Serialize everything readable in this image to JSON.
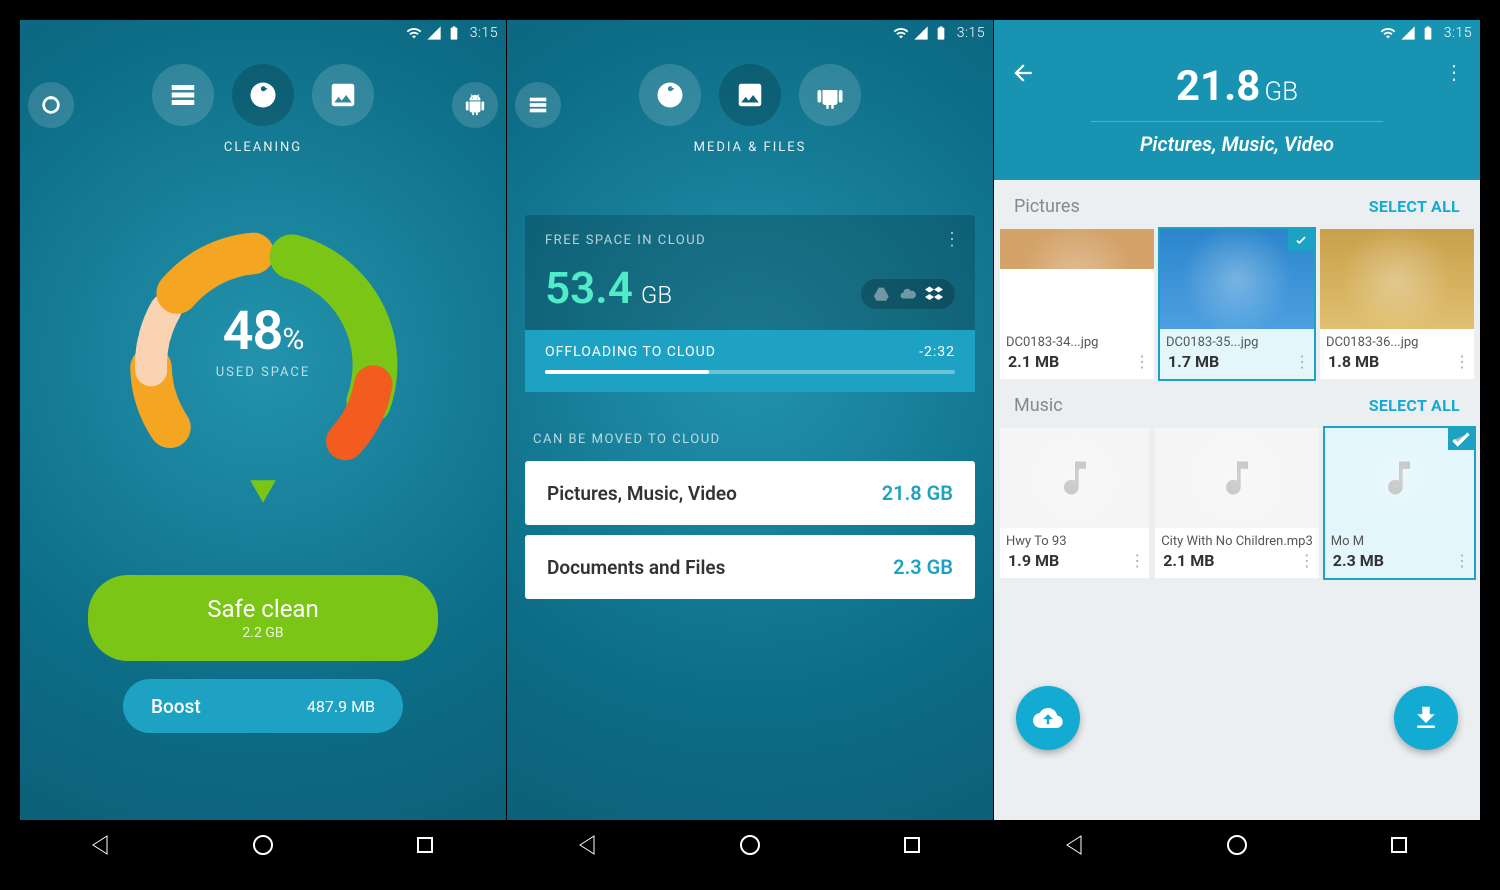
{
  "status": {
    "time": "3:15"
  },
  "screen1": {
    "circles_label": "CLEANING",
    "used_pct_number": "48",
    "used_pct_symbol": "%",
    "used_label": "USED SPACE",
    "safe_clean_label": "Safe clean",
    "safe_clean_amount": "2.2 GB",
    "boost_label": "Boost",
    "boost_amount": "487.9 MB"
  },
  "screen2": {
    "circles_label": "MEDIA & FILES",
    "cloud_title": "FREE SPACE IN CLOUD",
    "cloud_value": "53.4",
    "cloud_unit": "GB",
    "offload_label": "OFFLOADING TO CLOUD",
    "offload_time": "-2:32",
    "movable_label": "CAN BE MOVED TO CLOUD",
    "cards": [
      {
        "label": "Pictures, Music, Video",
        "value": "21.8 GB"
      },
      {
        "label": "Documents and Files",
        "value": "2.3 GB"
      }
    ]
  },
  "screen3": {
    "size_num": "21.8",
    "size_unit": "GB",
    "subtitle": "Pictures, Music, Video",
    "select_all": "SELECT ALL",
    "sections": {
      "pictures": {
        "name": "Pictures",
        "items": [
          {
            "name": "DC0183-34...jpg",
            "size": "2.1 MB",
            "selected": false
          },
          {
            "name": "DC0183-35...jpg",
            "size": "1.7 MB",
            "selected": true
          },
          {
            "name": "DC0183-36...jpg",
            "size": "1.8 MB",
            "selected": false
          }
        ]
      },
      "music": {
        "name": "Music",
        "items": [
          {
            "name": "Hwy To 93",
            "size": "1.9 MB",
            "selected": false
          },
          {
            "name": "City With No Children.mp3",
            "size": "2.1 MB",
            "selected": false
          },
          {
            "name": "Mo M",
            "size": "2.3 MB",
            "selected": true
          }
        ]
      }
    }
  }
}
